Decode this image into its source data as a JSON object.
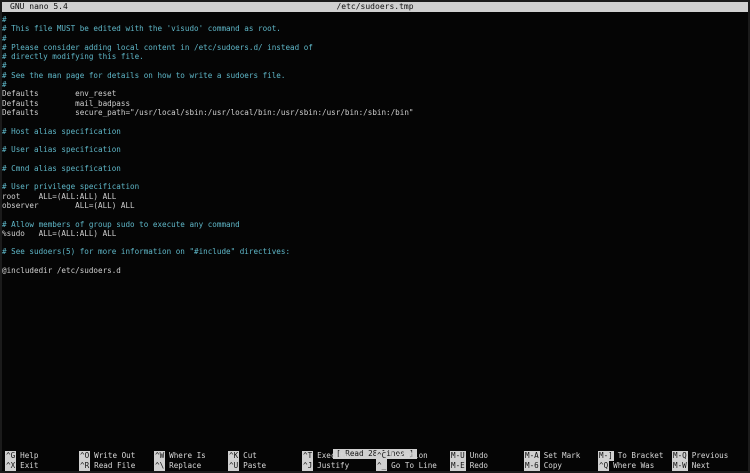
{
  "title_bar": {
    "version": "GNU nano 5.4",
    "filename": "/etc/sudoers.tmp"
  },
  "buffer": [
    {
      "text": "#",
      "type": "comment"
    },
    {
      "text": "# This file MUST be edited with the 'visudo' command as root.",
      "type": "comment"
    },
    {
      "text": "#",
      "type": "comment"
    },
    {
      "text": "# Please consider adding local content in /etc/sudoers.d/ instead of",
      "type": "comment"
    },
    {
      "text": "# directly modifying this file.",
      "type": "comment"
    },
    {
      "text": "#",
      "type": "comment"
    },
    {
      "text": "# See the man page for details on how to write a sudoers file.",
      "type": "comment"
    },
    {
      "text": "#",
      "type": "comment"
    },
    {
      "text": "Defaults        env_reset",
      "type": "code"
    },
    {
      "text": "Defaults        mail_badpass",
      "type": "code"
    },
    {
      "text": "Defaults        secure_path=\"/usr/local/sbin:/usr/local/bin:/usr/sbin:/usr/bin:/sbin:/bin\"",
      "type": "code"
    },
    {
      "text": "",
      "type": "code"
    },
    {
      "text": "# Host alias specification",
      "type": "comment"
    },
    {
      "text": "",
      "type": "code"
    },
    {
      "text": "# User alias specification",
      "type": "comment"
    },
    {
      "text": "",
      "type": "code"
    },
    {
      "text": "# Cmnd alias specification",
      "type": "comment"
    },
    {
      "text": "",
      "type": "code"
    },
    {
      "text": "# User privilege specification",
      "type": "comment"
    },
    {
      "text": "root    ALL=(ALL:ALL) ALL",
      "type": "code"
    },
    {
      "text": "observer        ALL=(ALL) ALL",
      "type": "code"
    },
    {
      "text": "",
      "type": "code"
    },
    {
      "text": "# Allow members of group sudo to execute any command",
      "type": "comment"
    },
    {
      "text": "%sudo   ALL=(ALL:ALL) ALL",
      "type": "code"
    },
    {
      "text": "",
      "type": "code"
    },
    {
      "text": "# See sudoers(5) for more information on \"#include\" directives:",
      "type": "comment"
    },
    {
      "text": "",
      "type": "code"
    },
    {
      "text": "@includedir /etc/sudoers.d",
      "type": "code"
    }
  ],
  "status_message": "[ Read 28 lines ]",
  "shortcuts": [
    {
      "key": "^G",
      "label": "Help",
      "icon": "help-shortcut"
    },
    {
      "key": "^O",
      "label": "Write Out",
      "icon": "write-out-shortcut"
    },
    {
      "key": "^W",
      "label": "Where Is",
      "icon": "where-is-shortcut"
    },
    {
      "key": "^K",
      "label": "Cut",
      "icon": "cut-shortcut"
    },
    {
      "key": "^T",
      "label": "Execute",
      "icon": "execute-shortcut"
    },
    {
      "key": "^C",
      "label": "Location",
      "icon": "location-shortcut"
    },
    {
      "key": "M-U",
      "label": "Undo",
      "icon": "undo-shortcut"
    },
    {
      "key": "M-A",
      "label": "Set Mark",
      "icon": "set-mark-shortcut"
    },
    {
      "key": "M-]",
      "label": "To Bracket",
      "icon": "to-bracket-shortcut"
    },
    {
      "key": "M-Q",
      "label": "Previous",
      "icon": "previous-shortcut"
    },
    {
      "key": "^X",
      "label": "Exit",
      "icon": "exit-shortcut"
    },
    {
      "key": "^R",
      "label": "Read File",
      "icon": "read-file-shortcut"
    },
    {
      "key": "^\\",
      "label": "Replace",
      "icon": "replace-shortcut"
    },
    {
      "key": "^U",
      "label": "Paste",
      "icon": "paste-shortcut"
    },
    {
      "key": "^J",
      "label": "Justify",
      "icon": "justify-shortcut"
    },
    {
      "key": "^_",
      "label": "Go To Line",
      "icon": "go-to-line-shortcut"
    },
    {
      "key": "M-E",
      "label": "Redo",
      "icon": "redo-shortcut"
    },
    {
      "key": "M-6",
      "label": "Copy",
      "icon": "copy-shortcut"
    },
    {
      "key": "^Q",
      "label": "Where Was",
      "icon": "where-was-shortcut"
    },
    {
      "key": "M-W",
      "label": "Next",
      "icon": "next-shortcut"
    }
  ],
  "colors": {
    "comment": "#5fb7c8",
    "text": "#cfcfcf",
    "background": "#050505",
    "bar": "#d0d0d0"
  }
}
